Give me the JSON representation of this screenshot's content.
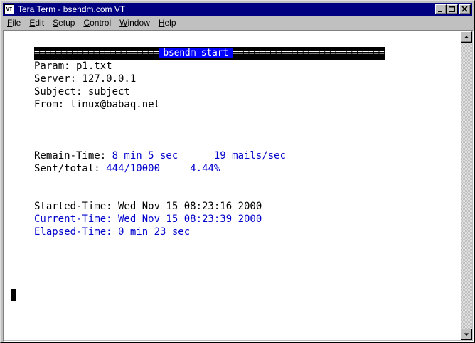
{
  "window": {
    "title": "Tera Term - bsendm.com VT",
    "icon_label": "VT",
    "icon": "terminal-app-icon"
  },
  "title_buttons": {
    "minimize": "minimize-icon",
    "maximize": "maximize-icon",
    "close": "close-icon"
  },
  "menu": {
    "items": [
      {
        "label_rest": "ile",
        "accel": "F"
      },
      {
        "label_rest": "dit",
        "accel": "E"
      },
      {
        "label_rest": "etup",
        "accel": "S"
      },
      {
        "label_rest": "ontrol",
        "accel": "C"
      },
      {
        "label_rest": "indow",
        "accel": "W"
      },
      {
        "label_rest": "elp",
        "accel": "H"
      }
    ]
  },
  "terminal": {
    "banner_left": "=======================",
    "banner_title": "bsendm start",
    "banner_right": "============================",
    "param": "Param: p1.txt",
    "server": "Server: 127.0.0.1",
    "subject": "Subject: subject",
    "from": "From: linux@babaq.net",
    "remain_label": "Remain-Time: ",
    "remain_value": "8 min 5 sec      19 mails/sec",
    "sent_label": "Sent/total: ",
    "sent_value": "444/10000     4.44%",
    "started": "Started-Time: Wed Nov 15 08:23:16 2000",
    "current": "Current-Time: Wed Nov 15 08:23:39 2000",
    "elapsed": "Elapsed-Time: 0 min 23 sec"
  },
  "colors": {
    "title_bar": "#000080",
    "terminal_bg": "#ffffff",
    "highlight_text": "#0000cc",
    "banner_highlight": "#0000ff"
  }
}
